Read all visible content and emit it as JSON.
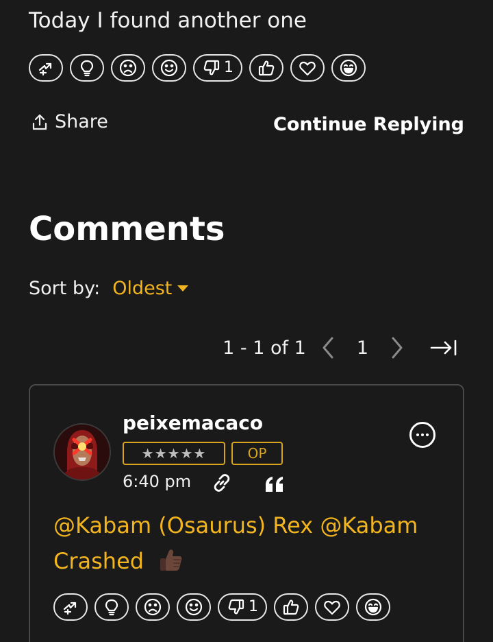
{
  "post": {
    "text": "Today I found another one",
    "reactions": [
      {
        "icon": "awesome-arrow-icon",
        "count": ""
      },
      {
        "icon": "lightbulb-icon",
        "count": ""
      },
      {
        "icon": "sad-face-icon",
        "count": ""
      },
      {
        "icon": "smile-face-icon",
        "count": ""
      },
      {
        "icon": "thumbs-down-icon",
        "count": "1"
      },
      {
        "icon": "thumbs-up-icon",
        "count": ""
      },
      {
        "icon": "heart-icon",
        "count": ""
      },
      {
        "icon": "laughing-face-icon",
        "count": ""
      }
    ],
    "share_label": "Share",
    "continue_label": "Continue Replying"
  },
  "comments": {
    "title": "Comments",
    "sort_label": "Sort by:",
    "sort_value": "Oldest",
    "pagination": {
      "range": "1 - 1 of 1",
      "current_page": "1"
    },
    "items": [
      {
        "username": "peixemacaco",
        "rank": "★★★★★",
        "op_badge": "OP",
        "time": "6:40 pm",
        "body": "@Kabam (Osaurus) Rex @Kabam Crashed",
        "body_emoji": "thumbs-up-dark-skin-emoji",
        "reactions": [
          {
            "icon": "awesome-arrow-icon",
            "count": ""
          },
          {
            "icon": "lightbulb-icon",
            "count": ""
          },
          {
            "icon": "sad-face-icon",
            "count": ""
          },
          {
            "icon": "smile-face-icon",
            "count": ""
          },
          {
            "icon": "thumbs-down-icon",
            "count": "1"
          },
          {
            "icon": "thumbs-up-icon",
            "count": ""
          },
          {
            "icon": "heart-icon",
            "count": ""
          },
          {
            "icon": "laughing-face-icon",
            "count": ""
          }
        ]
      }
    ]
  },
  "colors": {
    "background": "#1a1a1a",
    "accent": "#f2b520",
    "badge_border": "#d9a41e",
    "card_border": "#4a4a4a"
  }
}
